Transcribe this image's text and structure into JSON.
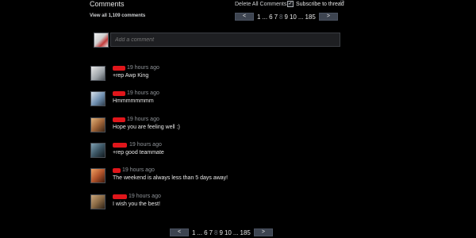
{
  "header": {
    "title": "Comments",
    "view_all": "View all 1,109 comments",
    "delete_all": "Delete All Comments",
    "subscribe_label": "Subscribe to thread",
    "subscribe_checked": true,
    "help_mark": "(?)"
  },
  "pagination_top": {
    "prev": "<",
    "next": ">",
    "first": "1",
    "ellipsis1": "...",
    "p6": "6",
    "p7": "7",
    "p8": "8",
    "p9": "9",
    "p10": "10",
    "ellipsis2": "...",
    "last": "185",
    "current": "8"
  },
  "add_comment": {
    "placeholder": "Add a comment"
  },
  "comments": [
    {
      "time": "19 hours ago",
      "text": "+rep Awp King",
      "avatar_color": "#b8bcc0"
    },
    {
      "time": "19 hours ago",
      "text": "Hmmmmmmmm",
      "avatar_color": "#6f8fb0"
    },
    {
      "time": "19 hours ago",
      "text": "Hope you are feeling well :)",
      "avatar_color": "#a3673a"
    },
    {
      "time": "19 hours ago",
      "text": "+rep good teammate",
      "avatar_color": "#3d5766"
    },
    {
      "time": "19 hours ago",
      "text": "The weekend is always less than 5 days away!",
      "avatar_color": "#b4552c"
    },
    {
      "time": "19 hours ago",
      "text": "I wish you the best!",
      "avatar_color": "#8a6a45"
    }
  ],
  "pagination_bottom": {
    "prev": "<",
    "next": ">",
    "first": "1",
    "ellipsis1": "...",
    "p6": "6",
    "p7": "7",
    "p8": "8",
    "p9": "9",
    "p10": "10",
    "ellipsis2": "...",
    "last": "185",
    "current": "8"
  },
  "colors": {
    "background": "#000000",
    "author_redaction": "#e0161b",
    "pager_button": "#3d4450"
  }
}
